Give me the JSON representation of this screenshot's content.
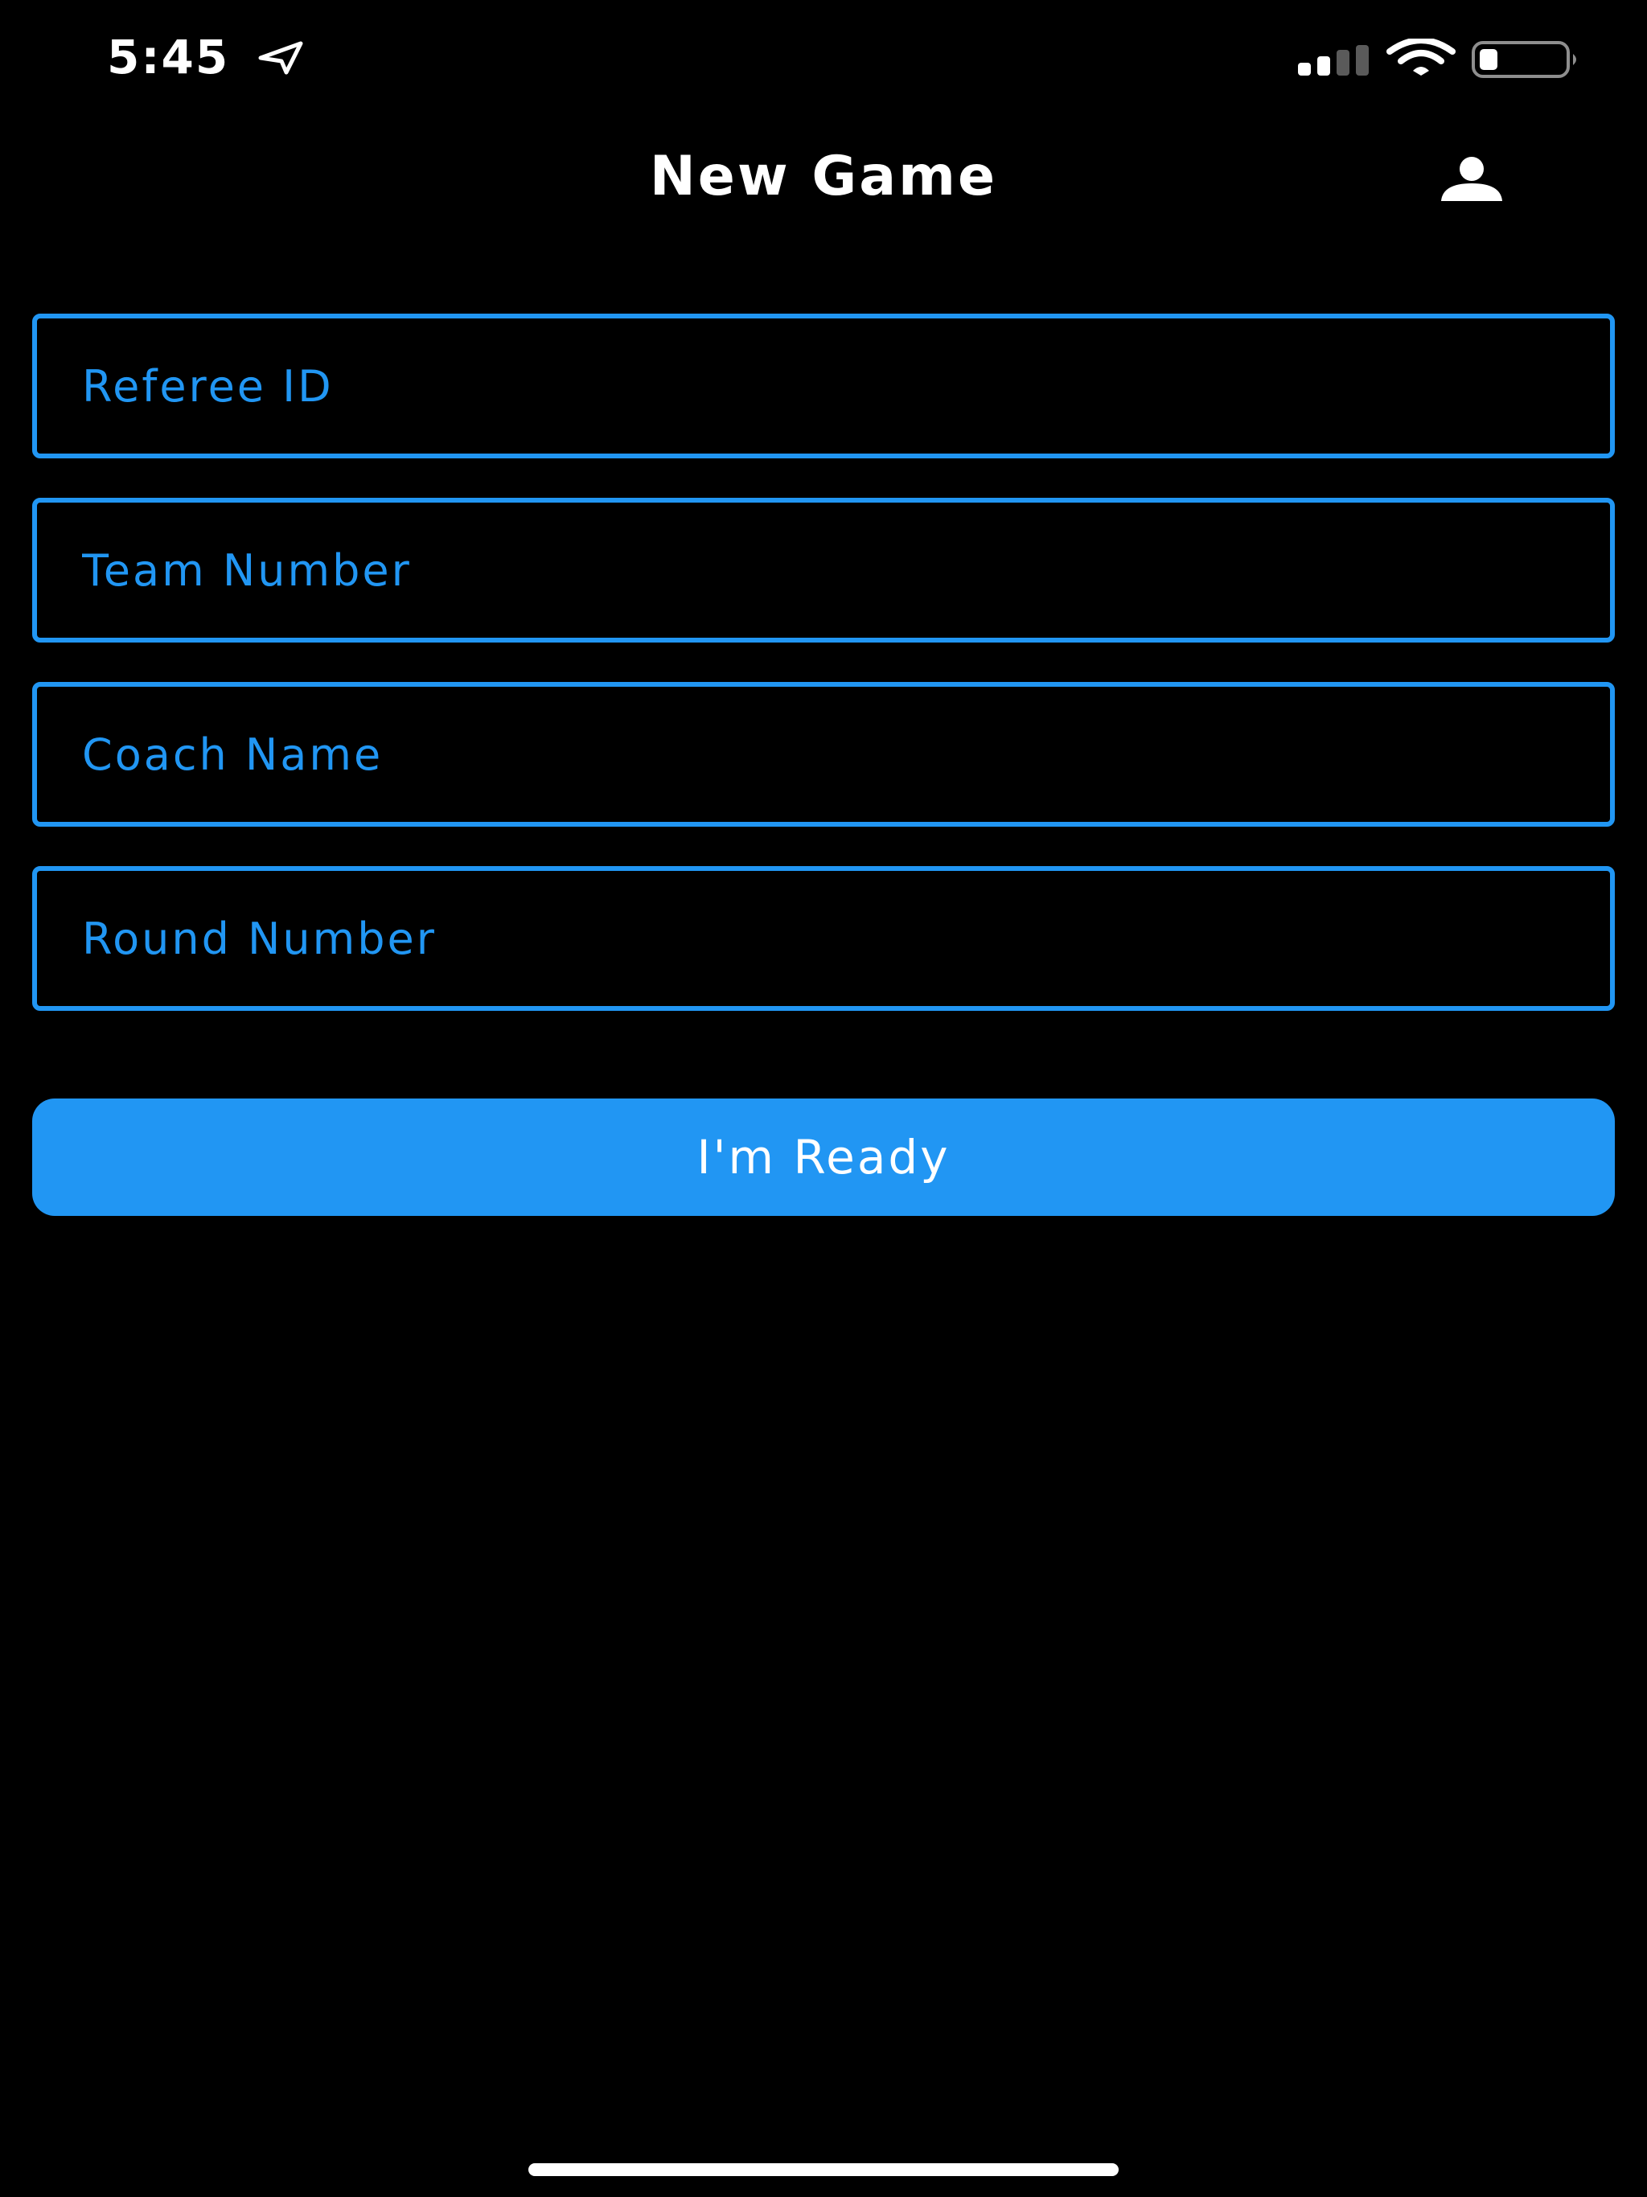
{
  "status_bar": {
    "time": "5:45",
    "icons": [
      "location-arrow-icon",
      "cellular-signal-icon",
      "wifi-icon",
      "battery-icon"
    ]
  },
  "header": {
    "title": "New Game",
    "profile_icon": "person-icon"
  },
  "form": {
    "fields": [
      {
        "placeholder": "Referee ID",
        "value": ""
      },
      {
        "placeholder": "Team Number",
        "value": ""
      },
      {
        "placeholder": "Coach Name",
        "value": ""
      },
      {
        "placeholder": "Round Number",
        "value": ""
      }
    ],
    "submit_label": "I'm Ready"
  },
  "colors": {
    "background": "#000000",
    "accent": "#2196F3",
    "text": "#FFFFFF"
  }
}
